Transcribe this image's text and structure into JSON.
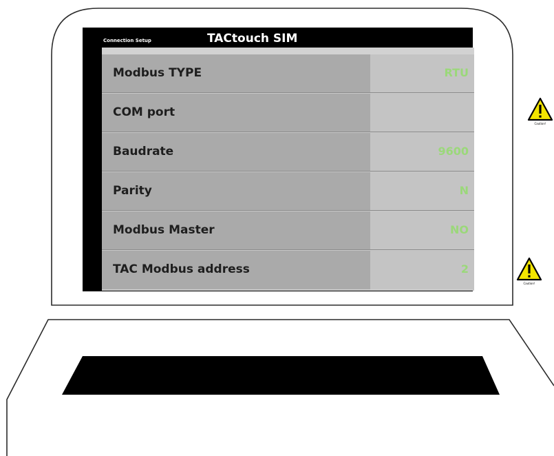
{
  "header": {
    "subtitle": "Connection Setup",
    "title": "TACtouch SIM"
  },
  "rows": [
    {
      "label": "Modbus TYPE",
      "value": "RTU"
    },
    {
      "label": "COM port",
      "value": ""
    },
    {
      "label": "Baudrate",
      "value": "9600"
    },
    {
      "label": "Parity",
      "value": "N"
    },
    {
      "label": "Modbus Master",
      "value": "NO"
    },
    {
      "label": "TAC Modbus address",
      "value": "2"
    }
  ],
  "caution_signs": [
    {
      "icon": "warning-triangle-icon",
      "label": "Caution!"
    },
    {
      "icon": "warning-triangle-icon",
      "label": "Caution!"
    }
  ],
  "colors": {
    "screen_background": "#000000",
    "label_cell": "#aaaaaa",
    "value_cell": "#c4c4c4",
    "value_text": "#9bd87a",
    "label_text": "#1e1e1e",
    "warning_fill": "#f3e500",
    "device_outline": "#2b2b2b",
    "keyboard_slot": "#000000"
  }
}
